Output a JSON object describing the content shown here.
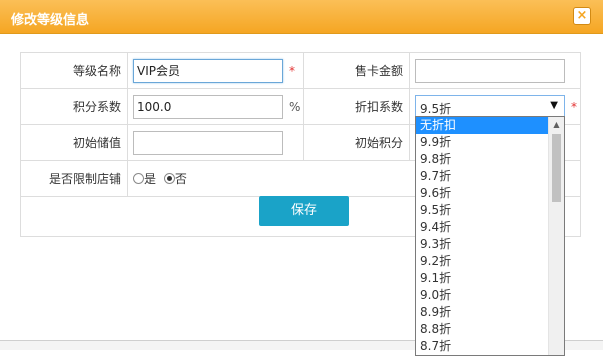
{
  "dialog": {
    "title": "修改等级信息",
    "close_glyph": "×"
  },
  "form": {
    "grade_name_label": "等级名称",
    "grade_name_value": "VIP会员",
    "card_price_label": "售卡金额",
    "card_price_value": "",
    "points_ratio_label": "积分系数",
    "points_ratio_value": "100.0",
    "points_ratio_unit": "%",
    "discount_ratio_label": "折扣系数",
    "discount_selected": "9.5折",
    "initial_balance_label": "初始储值",
    "initial_balance_value": "",
    "initial_points_label": "初始积分",
    "limit_store_label": "是否限制店铺",
    "limit_store_yes": "是",
    "limit_store_no": "否",
    "limit_store_selected": "否",
    "required_mark": "*"
  },
  "save_button": {
    "label": "保存"
  },
  "discount_dropdown": {
    "highlighted": "无折扣",
    "options": [
      "无折扣",
      "9.9折",
      "9.8折",
      "9.7折",
      "9.6折",
      "9.5折",
      "9.4折",
      "9.3折",
      "9.2折",
      "9.1折",
      "9.0折",
      "8.9折",
      "8.8折",
      "8.7折"
    ]
  },
  "colors": {
    "title_bar": "#f5a623",
    "save_button": "#1aa3c8",
    "dropdown_highlight": "#1e90ff",
    "required": "#e33333"
  }
}
